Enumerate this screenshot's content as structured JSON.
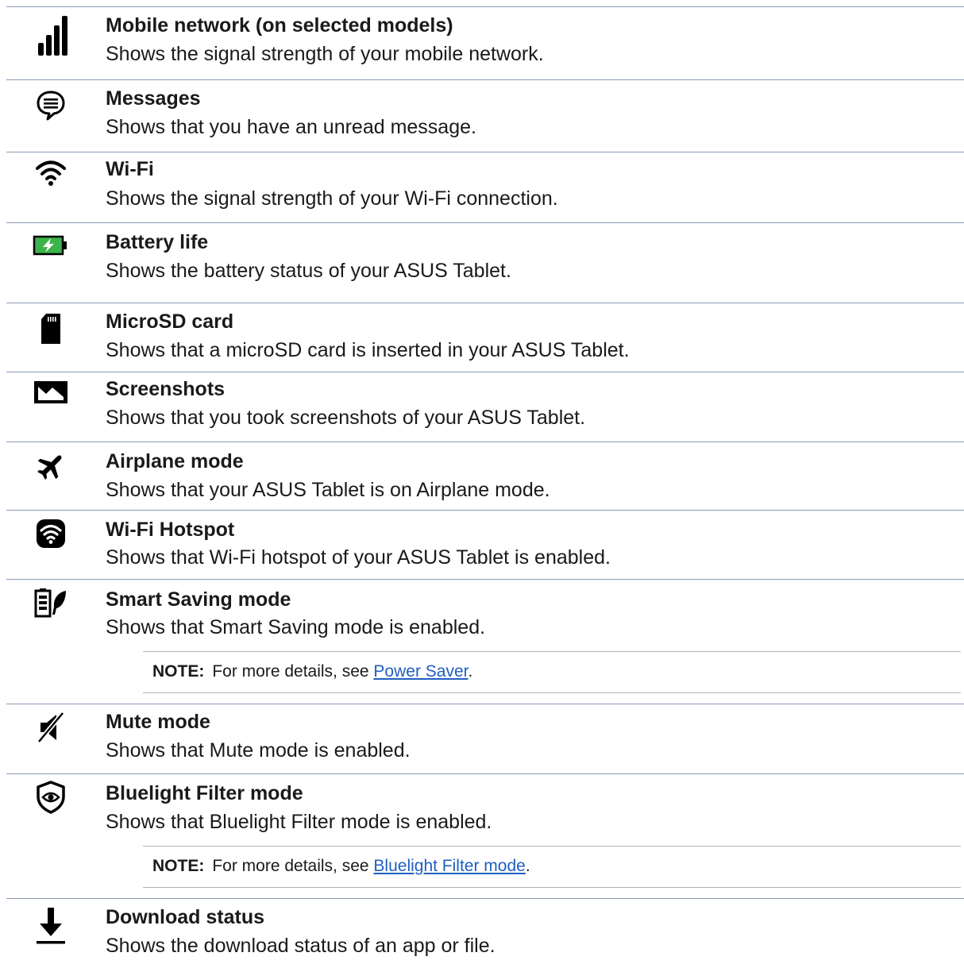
{
  "items": [
    {
      "icon": "signal-bars-icon",
      "title": "Mobile network (on selected models)",
      "desc": "Shows the signal strength of your mobile network."
    },
    {
      "icon": "message-bubble-icon",
      "title": "Messages",
      "desc": "Shows that you have an unread message."
    },
    {
      "icon": "wifi-icon",
      "title": "Wi-Fi",
      "desc": "Shows the signal strength of your Wi-Fi connection."
    },
    {
      "icon": "battery-charging-icon",
      "title": "Battery life",
      "desc": "Shows the battery status of your ASUS Tablet."
    },
    {
      "icon": "microsd-card-icon",
      "title": "MicroSD card",
      "desc": "Shows that a microSD card is inserted in your ASUS Tablet."
    },
    {
      "icon": "screenshot-image-icon",
      "title": "Screenshots",
      "desc": "Shows that you took screenshots of your ASUS Tablet."
    },
    {
      "icon": "airplane-icon",
      "title": "Airplane mode",
      "desc": "Shows that your ASUS Tablet is on Airplane mode."
    },
    {
      "icon": "wifi-hotspot-icon",
      "title": "Wi-Fi Hotspot",
      "desc": "Shows that Wi-Fi hotspot of your ASUS Tablet is enabled."
    },
    {
      "icon": "battery-leaf-icon",
      "title": "Smart Saving mode",
      "desc": "Shows that Smart Saving mode is enabled."
    },
    {
      "icon": "mute-speaker-icon",
      "title": "Mute mode",
      "desc": "Shows that Mute mode is enabled."
    },
    {
      "icon": "shield-eye-icon",
      "title": "Bluelight Filter mode",
      "desc": "Shows that Bluelight Filter mode is enabled."
    },
    {
      "icon": "download-arrow-icon",
      "title": "Download status",
      "desc": "Shows the download status of an app or file."
    }
  ],
  "notes": [
    {
      "label": "NOTE:",
      "text": "For more details, see ",
      "link": "Power Saver",
      "after": "."
    },
    {
      "label": "NOTE:",
      "text": "For more details, see ",
      "link": "Bluelight Filter mode",
      "after": "."
    }
  ],
  "colors": {
    "rule": "#8a9bb8",
    "note_rule": "#b5b5b5",
    "link": "#1f5fbf",
    "battery_green": "#3cb44a"
  }
}
